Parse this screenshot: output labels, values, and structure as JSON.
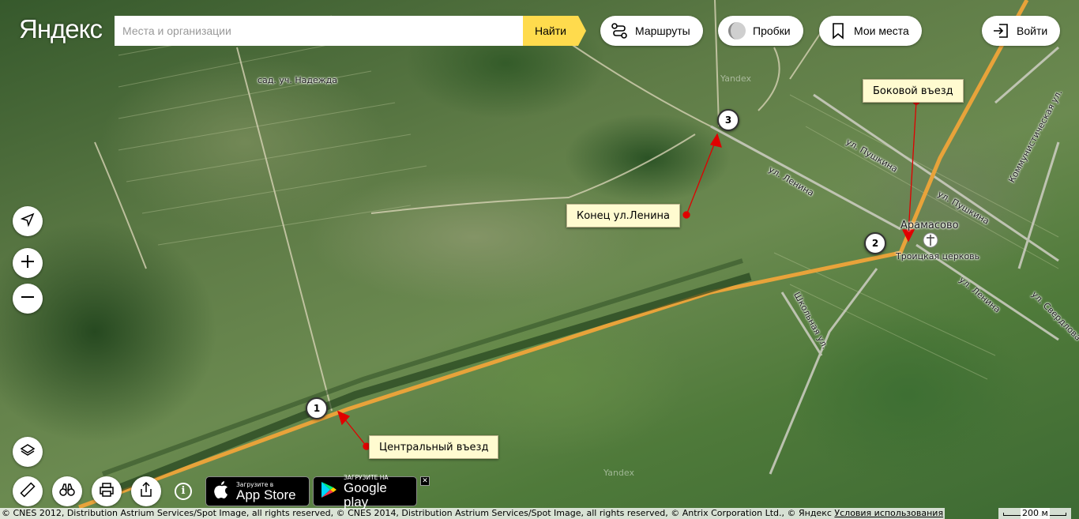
{
  "header": {
    "logo": "Яндекс",
    "search_placeholder": "Места и организации",
    "search_button": "Найти",
    "routes_label": "Маршруты",
    "traffic_label": "Пробки",
    "my_places_label": "Мои места",
    "login_label": "Войти"
  },
  "map": {
    "labels": {
      "sad": "сад. уч. Надежда",
      "village": "Арамасово",
      "church": "Троицкая церковь",
      "pushkina1": "ул. Пушкина",
      "pushkina2": "ул. Пушкина",
      "lenina1": "ул. Ленина",
      "lenina2": "ул. Ленина",
      "kommun": "Коммунистическая ул.",
      "shkolnaya": "Школьная ул.",
      "sverdlova": "ул. Свердлова",
      "yandex_wm1": "Yandex",
      "yandex_wm2": "Yandex"
    },
    "callouts": {
      "central": "Центральный въезд",
      "lenina_end": "Конец ул.Ленина",
      "side": "Боковой въезд"
    },
    "markers": {
      "m1": "1",
      "m2": "2",
      "m3": "3"
    }
  },
  "badges": {
    "appstore_small": "Загрузите в",
    "appstore_big": "App Store",
    "googleplay_small": "ЗАГРУЗИТЕ НА",
    "googleplay_big": "Google play",
    "close": "✕"
  },
  "footer": {
    "copyright": "© CNES 2012, Distribution Astrium Services/Spot Image, all rights reserved, © CNES 2014, Distribution Astrium Services/Spot Image, all rights reserved, © Antrix Corporation Ltd., © Яндекс",
    "terms": "Условия использования",
    "scale": "200 м"
  },
  "info_label": "i",
  "icons": [
    "route-icon",
    "traffic-icon",
    "bookmark-icon",
    "login-icon",
    "locate-icon",
    "zoom-in-icon",
    "zoom-out-icon",
    "layers-icon",
    "ruler-icon",
    "binoculars-icon",
    "print-icon",
    "share-icon",
    "info-icon",
    "apple-icon",
    "google-play-icon"
  ],
  "colors": {
    "search_button": "#ffdb4d",
    "road": "#e8a33a",
    "callout_bg": "#fffbd0",
    "marker_line": "#e00000"
  }
}
